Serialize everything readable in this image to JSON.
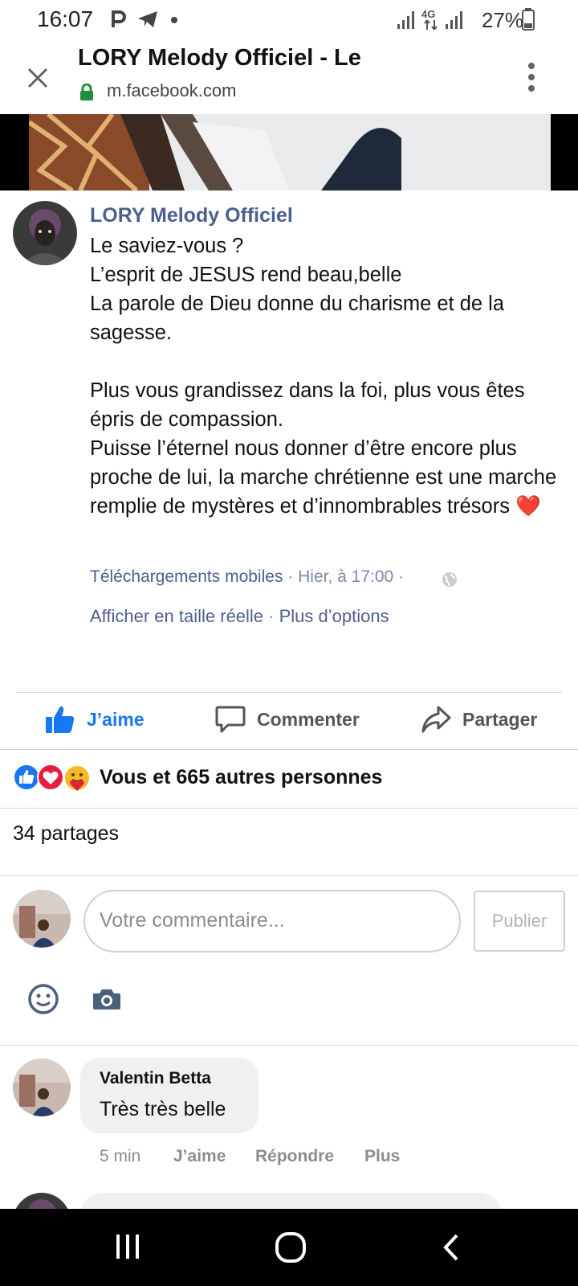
{
  "status_bar": {
    "time": "16:07",
    "network": "4G",
    "battery": "27%"
  },
  "browser": {
    "page_title": "LORY Melody Officiel - Le",
    "url": "m.facebook.com",
    "icons": [
      "close-icon",
      "lock-icon",
      "more-vert-icon"
    ]
  },
  "post": {
    "author": "LORY Melody Officiel",
    "text": "Le saviez-vous ?\nL’esprit de JESUS rend beau,belle\nLa parole de Dieu donne du charisme et de la sagesse.\n\nPlus vous grandissez dans la foi, plus vous êtes épris de compassion.\nPuisse l’éternel nous donner d’être encore plus proche de lui, la marche chrétienne est une marche remplie de mystères et d’innombrables trésors ❤️",
    "album": "Téléchargements mobiles",
    "time": "Hier, à 17:00",
    "view_full_size": "Afficher en taille réelle",
    "more_options": "Plus d’options",
    "separator": " · "
  },
  "actions": {
    "like": "J’aime",
    "comment": "Commenter",
    "share": "Partager"
  },
  "reactions": {
    "summary": "Vous et 665 autres personnes",
    "shares": "34 partages"
  },
  "comment_box": {
    "placeholder": "Votre commentaire...",
    "publish": "Publier"
  },
  "comments": [
    {
      "author": "Valentin Betta",
      "text": "Très très belle",
      "time": "5 min",
      "like": "J’aime",
      "reply": "Répondre",
      "more": "Plus"
    }
  ],
  "colors": {
    "facebook_blue": "#1877f2",
    "link_blue": "#4b5f8f",
    "heart_red": "#e41e3f"
  }
}
